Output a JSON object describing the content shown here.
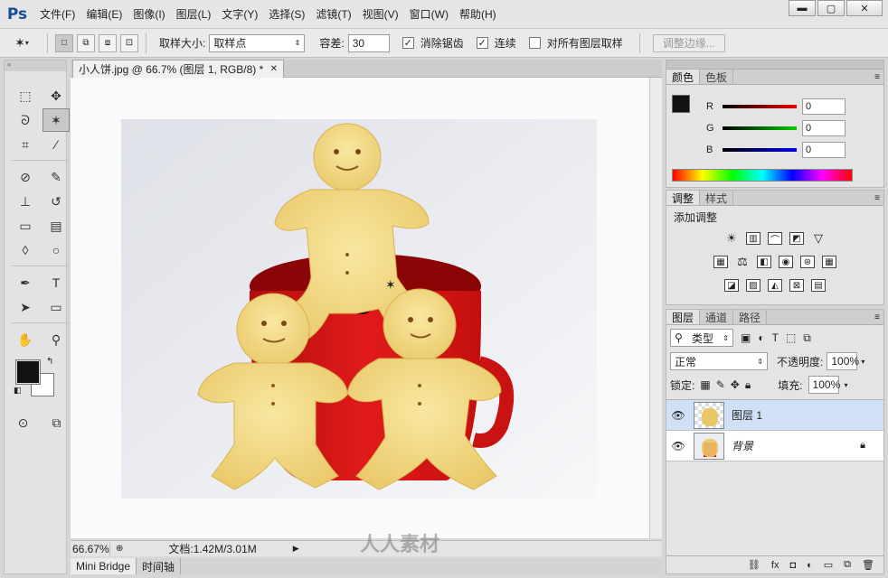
{
  "app": {
    "logo": "Ps"
  },
  "menu": [
    "文件(F)",
    "编辑(E)",
    "图像(I)",
    "图层(L)",
    "文字(Y)",
    "选择(S)",
    "滤镜(T)",
    "视图(V)",
    "窗口(W)",
    "帮助(H)"
  ],
  "window_controls": {
    "minimize": "▬",
    "maximize": "▢",
    "close": "✕"
  },
  "options": {
    "sample_size_label": "取样大小:",
    "sample_size_value": "取样点",
    "tolerance_label": "容差:",
    "tolerance_value": "30",
    "antialias_label": "消除锯齿",
    "antialias_checked": true,
    "contiguous_label": "连续",
    "contiguous_checked": true,
    "all_layers_label": "对所有图层取样",
    "all_layers_checked": false,
    "refine_edge_label": "调整边缘..."
  },
  "document": {
    "tab_title": "小人饼.jpg @ 66.7% (图层 1, RGB/8) *",
    "zoom": "66.67%",
    "doc_info": "文档:1.42M/3.01M"
  },
  "bottom_tabs": [
    "Mini Bridge",
    "时间轴"
  ],
  "color_panel": {
    "tabs": [
      "颜色",
      "色板"
    ],
    "r_label": "R",
    "g_label": "G",
    "b_label": "B",
    "r": "0",
    "g": "0",
    "b": "0"
  },
  "adjust_panel": {
    "tabs": [
      "调整",
      "样式"
    ],
    "title": "添加调整"
  },
  "layers_panel": {
    "tabs": [
      "图层",
      "通道",
      "路径"
    ],
    "filter_label": "类型",
    "blend_mode": "正常",
    "opacity_label": "不透明度:",
    "opacity": "100%",
    "lock_label": "锁定:",
    "fill_label": "填充:",
    "fill": "100%",
    "layers": [
      {
        "name": "图层 1",
        "selected": true
      },
      {
        "name": "背景",
        "selected": false
      }
    ]
  },
  "watermark": "人人素材",
  "colors": {
    "selection_blue": "#cfe0f7",
    "ps_blue": "#1a4c9c"
  }
}
